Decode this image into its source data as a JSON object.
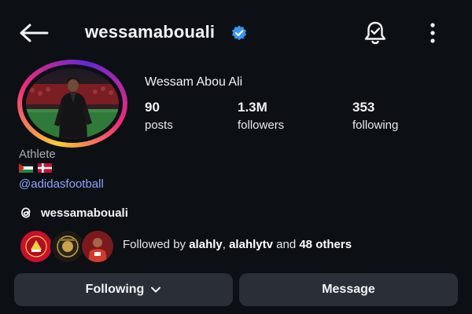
{
  "header": {
    "username": "wessamabouali",
    "verified_icon": "verified-badge-icon",
    "back_icon": "back-arrow-icon",
    "bell_icon": "notification-bell-icon",
    "more_icon": "more-options-icon"
  },
  "profile": {
    "full_name": "Wessam Abou Ali",
    "stats": [
      {
        "value": "90",
        "label": "posts"
      },
      {
        "value": "1.3M",
        "label": "followers"
      },
      {
        "value": "353",
        "label": "following"
      }
    ],
    "category": "Athlete",
    "flags": [
      "palestine-flag",
      "denmark-flag"
    ],
    "bio_link": "@adidasfootball",
    "threads_icon": "threads-icon",
    "threads_handle": "wessamabouali"
  },
  "followed_by": {
    "prefix": "Followed by ",
    "names": [
      "alahly",
      "alahlytv"
    ],
    "separator": ", ",
    "middle": " and ",
    "others": "48 others"
  },
  "buttons": {
    "following_label": "Following",
    "message_label": "Message",
    "chevron_icon": "chevron-down-icon"
  },
  "colors": {
    "background": "#0c0f14",
    "button": "#2a2e36",
    "link": "#8ea4ff",
    "verified": "#3897f0"
  }
}
